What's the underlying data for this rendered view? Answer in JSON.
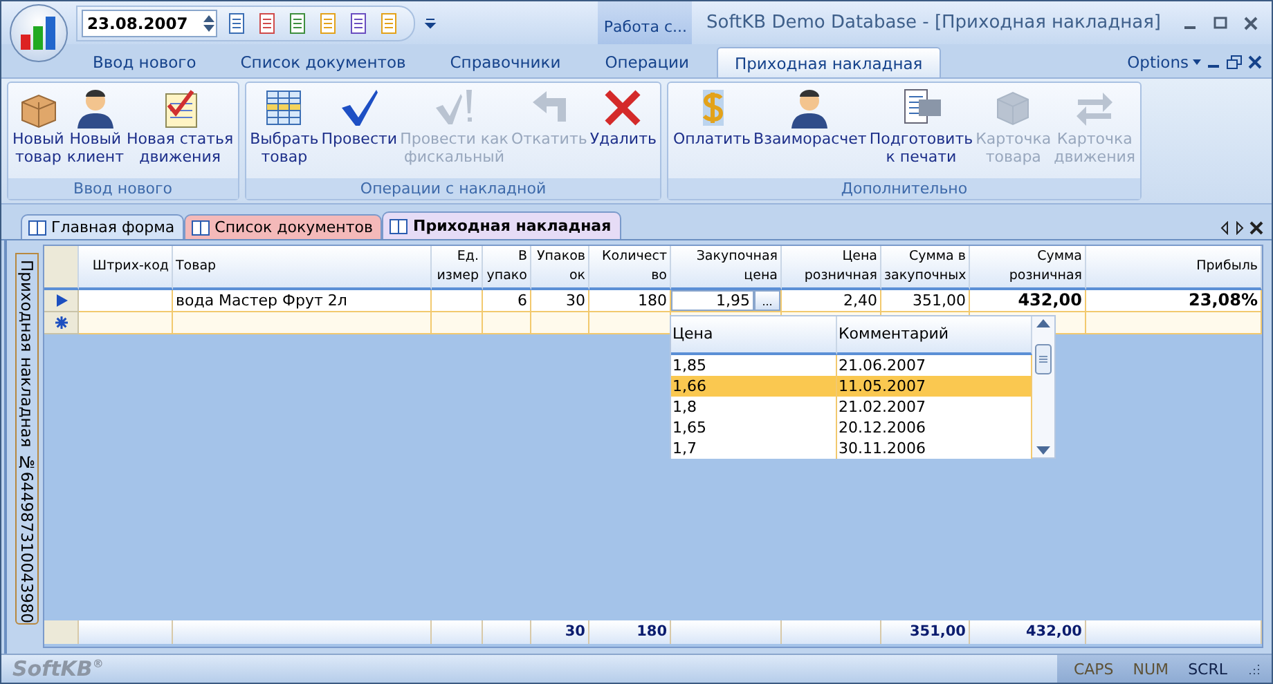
{
  "window": {
    "title": "SoftKB Demo Database - [Приходная накладная]",
    "context_tab": "Работа с..."
  },
  "quick_access": {
    "date": "23.08.2007"
  },
  "ribbon_tabs": [
    {
      "label": "Ввод нового",
      "selected": false
    },
    {
      "label": "Список документов",
      "selected": false
    },
    {
      "label": "Справочники",
      "selected": false
    },
    {
      "label": "Операции",
      "selected": false
    },
    {
      "label": "Приходная накладная",
      "selected": true
    }
  ],
  "options_menu": "Options",
  "ribbon_groups": [
    {
      "title": "Ввод нового",
      "buttons": [
        {
          "label": "Новый\nтовар",
          "kind": "box",
          "disabled": false
        },
        {
          "label": "Новый\nклиент",
          "kind": "person",
          "disabled": false
        },
        {
          "label": "Новая статья\nдвижения",
          "kind": "checklist",
          "disabled": false
        }
      ]
    },
    {
      "title": "Операции с накладной",
      "buttons": [
        {
          "label": "Выбрать\nтовар",
          "kind": "table",
          "disabled": false
        },
        {
          "label": "Провести",
          "kind": "check",
          "disabled": false
        },
        {
          "label": "Провести как\nфискальный",
          "kind": "check-exclaim",
          "disabled": true
        },
        {
          "label": "Откатить",
          "kind": "back-arrow",
          "disabled": true
        },
        {
          "label": "Удалить",
          "kind": "cross",
          "disabled": false
        }
      ]
    },
    {
      "title": "Дополнительно",
      "buttons": [
        {
          "label": "Оплатить",
          "kind": "dollar",
          "disabled": false
        },
        {
          "label": "Взаиморасчет",
          "kind": "person",
          "disabled": false
        },
        {
          "label": "Подготовить\nк печати",
          "kind": "printer",
          "disabled": false
        },
        {
          "label": "Карточка\nтовара",
          "kind": "cube",
          "disabled": true
        },
        {
          "label": "Карточка\nдвижения",
          "kind": "swap-arrows",
          "disabled": true
        }
      ]
    }
  ],
  "doc_tabs": [
    {
      "label": "Главная форма",
      "selected": false,
      "color": "#d4e3f7"
    },
    {
      "label": "Список документов",
      "selected": false,
      "color": "#f4b9b9"
    },
    {
      "label": "Приходная накладная",
      "selected": true,
      "color": "#e6dcf6"
    }
  ],
  "side_tab": "Приходная накладная №644987310043980",
  "grid": {
    "columns": [
      "Штрих-код",
      "Товар",
      "Ед.\nизмер",
      "В\nупако",
      "Упаков\nок",
      "Количест\nво",
      "Закупочная\nцена",
      "Цена\nрозничная",
      "Сумма в\nзакупочных",
      "Сумма\nрозничная",
      "Прибыль"
    ],
    "rows": [
      {
        "kind": "current",
        "cells": [
          "",
          "вода Мастер Фрут 2л",
          "",
          "6",
          "30",
          "180",
          "1,95",
          "2,40",
          "351,00",
          "432,00",
          "23,08%"
        ]
      },
      {
        "kind": "new",
        "cells": [
          "",
          "",
          "",
          "",
          "",
          "",
          "",
          "",
          "",
          "",
          ""
        ]
      }
    ],
    "editor_button": "...",
    "totals": {
      "packs": "30",
      "quantity": "180",
      "purchase_sum": "351,00",
      "retail_sum": "432,00"
    }
  },
  "price_dropdown": {
    "columns": [
      "Цена",
      "Комментарий"
    ],
    "rows": [
      {
        "price": "1,85",
        "comment": "21.06.2007",
        "selected": false
      },
      {
        "price": "1,66",
        "comment": "11.05.2007",
        "selected": true
      },
      {
        "price": "1,8",
        "comment": "21.02.2007",
        "selected": false
      },
      {
        "price": "1,65",
        "comment": "20.12.2006",
        "selected": false
      },
      {
        "price": "1,7",
        "comment": "30.11.2006",
        "selected": false
      }
    ]
  },
  "status_bar": {
    "brand": "SoftKB$^{®}$",
    "indicators": [
      {
        "label": "CAPS",
        "on": false
      },
      {
        "label": "NUM",
        "on": false
      },
      {
        "label": "SCRL",
        "on": true
      }
    ]
  }
}
